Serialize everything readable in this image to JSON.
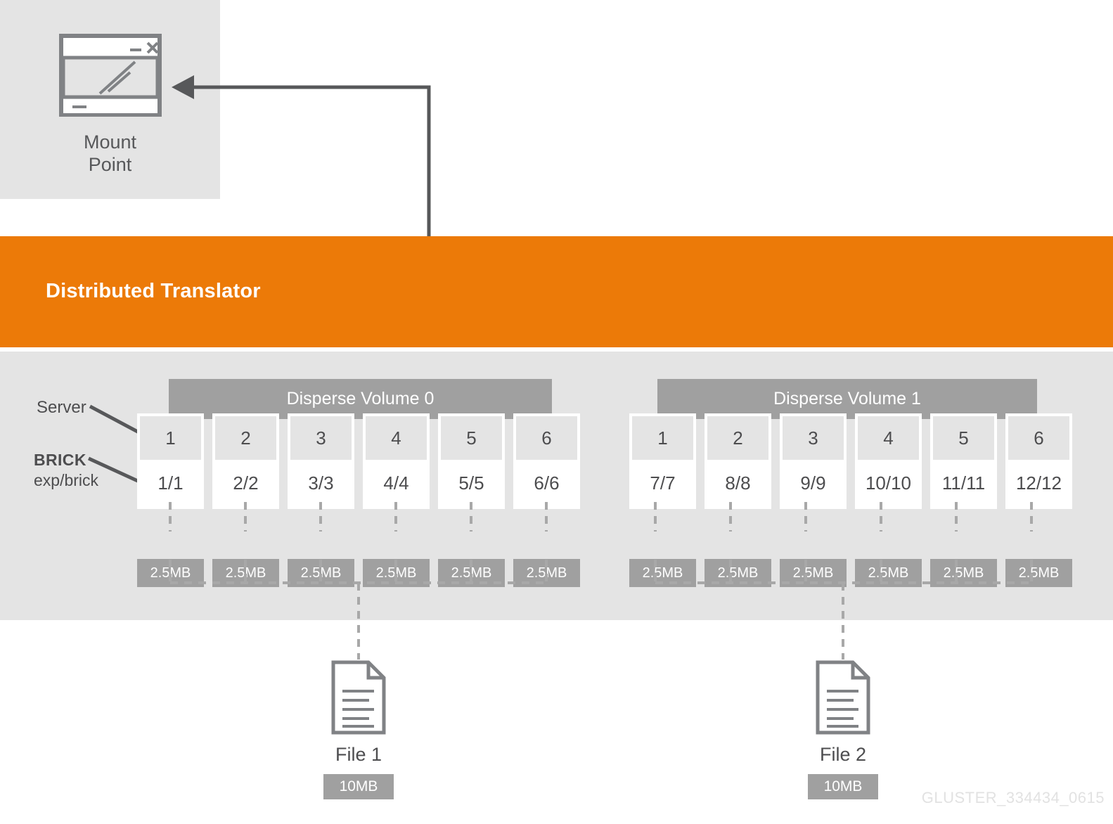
{
  "mount": {
    "label_line1": "Mount",
    "label_line2": "Point",
    "icon": "window-icon"
  },
  "translator": {
    "title": "Distributed Translator",
    "color": "#ec7a08"
  },
  "annotations": {
    "server": "Server",
    "brick": "BRICK",
    "brick_sub": "exp/brick"
  },
  "volumes": [
    {
      "title": "Disperse Volume 0",
      "servers": [
        "1",
        "2",
        "3",
        "4",
        "5",
        "6"
      ],
      "bricks": [
        "1/1",
        "2/2",
        "3/3",
        "4/4",
        "5/5",
        "6/6"
      ],
      "chunks": [
        "2.5MB",
        "2.5MB",
        "2.5MB",
        "2.5MB",
        "2.5MB",
        "2.5MB"
      ]
    },
    {
      "title": "Disperse Volume 1",
      "servers": [
        "1",
        "2",
        "3",
        "4",
        "5",
        "6"
      ],
      "bricks": [
        "7/7",
        "8/8",
        "9/9",
        "10/10",
        "11/11",
        "12/12"
      ],
      "chunks": [
        "2.5MB",
        "2.5MB",
        "2.5MB",
        "2.5MB",
        "2.5MB",
        "2.5MB"
      ]
    }
  ],
  "files": [
    {
      "label": "File 1",
      "size": "10MB"
    },
    {
      "label": "File 2",
      "size": "10MB"
    }
  ],
  "watermark": "GLUSTER_334434_0615",
  "colors": {
    "orange": "#ec7a08",
    "panel_gray": "#e4e4e4",
    "mid_gray": "#a0a0a0",
    "text_gray": "#4d4d4f",
    "line_gray": "#57585a"
  }
}
